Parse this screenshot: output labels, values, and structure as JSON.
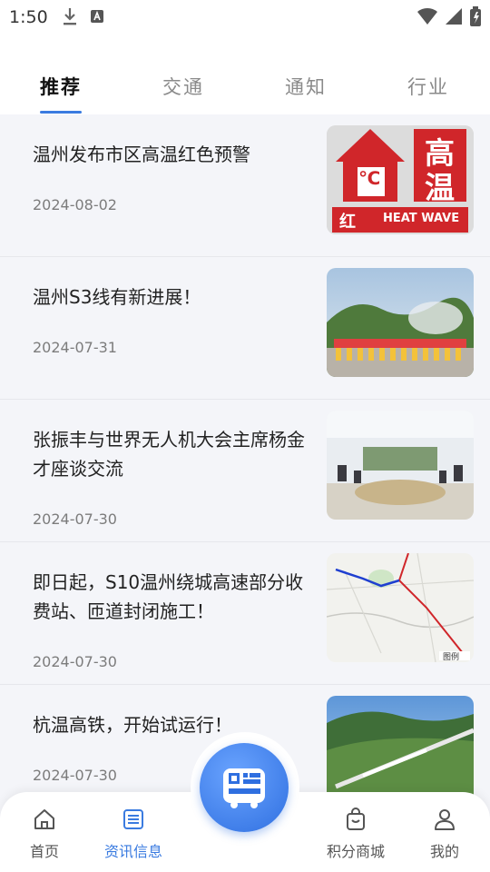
{
  "status_bar": {
    "time": "1:50"
  },
  "tabs": [
    {
      "label": "推荐",
      "active": true
    },
    {
      "label": "交通",
      "active": false
    },
    {
      "label": "通知",
      "active": false
    },
    {
      "label": "行业",
      "active": false
    }
  ],
  "news": [
    {
      "title": "温州发布市区高温红色预警",
      "date": "2024-08-02",
      "thumb": "heat-wave-warning-image",
      "thumb_text": {
        "big1": "高",
        "big2": "温",
        "small": "红",
        "banner": "HEAT WAVE",
        "unit": "℃"
      }
    },
    {
      "title": "温州S3线有新进展！",
      "date": "2024-07-31",
      "thumb": "construction-team-photo"
    },
    {
      "title": "张振丰与世界无人机大会主席杨金才座谈交流",
      "date": "2024-07-30",
      "thumb": "meeting-room-photo"
    },
    {
      "title": "即日起，S10温州绕城高速部分收费站、匝道封闭施工！",
      "date": "2024-07-30",
      "thumb": "highway-map-image",
      "thumb_text": {
        "legend": "图例"
      }
    },
    {
      "title": "杭温高铁，开始试运行！",
      "date": "2024-07-30",
      "thumb": "high-speed-rail-photo"
    }
  ],
  "bottom_nav": [
    {
      "label": "首页",
      "icon": "home-icon",
      "active": false
    },
    {
      "label": "资讯信息",
      "icon": "news-list-icon",
      "active": true
    },
    {
      "label": "积分商城",
      "icon": "shopping-bag-icon",
      "active": false
    },
    {
      "label": "我的",
      "icon": "user-icon",
      "active": false
    }
  ],
  "fab": {
    "icon": "bus-qr-code-icon"
  },
  "colors": {
    "accent": "#3a7be0",
    "background": "#f4f5f9"
  }
}
